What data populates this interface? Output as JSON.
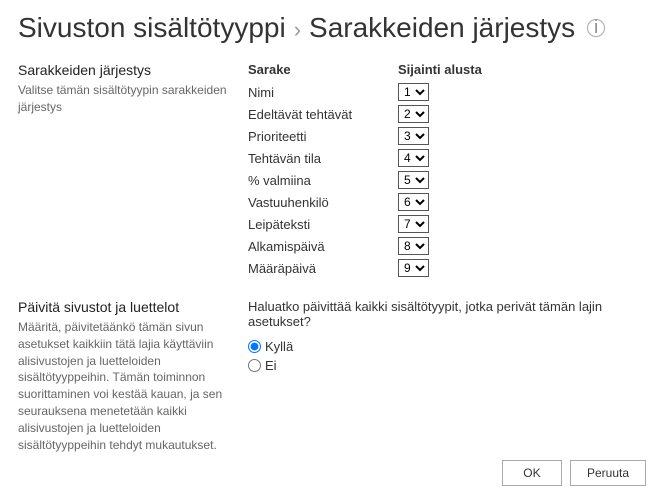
{
  "header": {
    "title": "Sivuston sisältötyyppi",
    "separator": "›",
    "subtitle": "Sarakkeiden järjestys"
  },
  "section_order": {
    "heading": "Sarakkeiden järjestys",
    "desc": "Valitse tämän sisältötyypin sarakkeiden järjestys",
    "col_header_name": "Sarake",
    "col_header_pos": "Sijainti alusta",
    "rows": [
      {
        "name": "Nimi",
        "pos": "1"
      },
      {
        "name": "Edeltävät tehtävät",
        "pos": "2"
      },
      {
        "name": "Prioriteetti",
        "pos": "3"
      },
      {
        "name": "Tehtävän tila",
        "pos": "4"
      },
      {
        "name": "% valmiina",
        "pos": "5"
      },
      {
        "name": "Vastuuhenkilö",
        "pos": "6"
      },
      {
        "name": "Leipäteksti",
        "pos": "7"
      },
      {
        "name": "Alkamispäivä",
        "pos": "8"
      },
      {
        "name": "Määräpäivä",
        "pos": "9"
      }
    ]
  },
  "section_update": {
    "heading": "Päivitä sivustot ja luettelot",
    "desc": "Määritä, päivitetäänkö tämän sivun asetukset kaikkiin tätä lajia käyttäviin alisivustojen ja luetteloiden sisältötyyppeihin. Tämän toiminnon suorittaminen voi kestää kauan, ja sen seurauksena menetetään kaikki alisivustojen ja luetteloiden sisältötyyppeihin tehdyt mukautukset.",
    "question": "Haluatko päivittää kaikki sisältötyypit, jotka perivät tämän lajin asetukset?",
    "opt_yes": "Kyllä",
    "opt_no": "Ei"
  },
  "buttons": {
    "ok": "OK",
    "cancel": "Peruuta"
  }
}
